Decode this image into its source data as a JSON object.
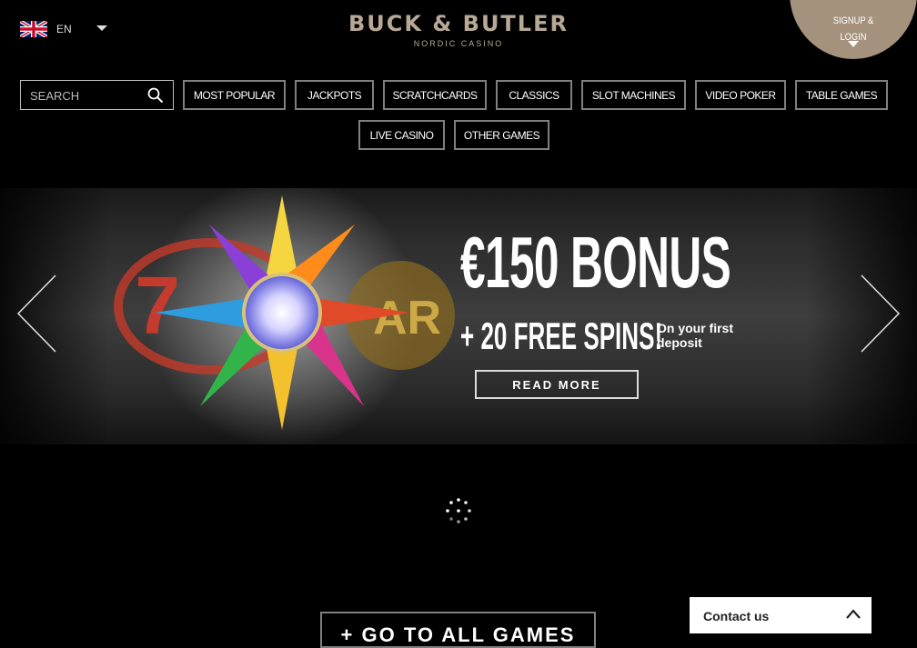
{
  "header": {
    "language": {
      "code": "EN",
      "flag_icon": "uk-flag-icon"
    },
    "brand": {
      "name": "BUCK & BUTLER",
      "subtitle": "NORDIC CASINO",
      "color": "#b7a995"
    },
    "signup": {
      "label_line1": "SIGNUP &",
      "label_line2": "LOGIN",
      "bg_color": "#a5927c"
    }
  },
  "search": {
    "placeholder": "SEARCH",
    "value": ""
  },
  "categories": [
    "MOST POPULAR",
    "JACKPOTS",
    "SCRATCHCARDS",
    "CLASSICS",
    "SLOT MACHINES",
    "VIDEO POKER",
    "TABLE GAMES",
    "LIVE CASINO",
    "OTHER GAMES"
  ],
  "banner": {
    "title": "€150 BONUS",
    "spins": "+ 20 FREE SPINS!",
    "note": "On your first deposit",
    "read_more": "READ MORE"
  },
  "footer": {
    "all_games": "+ GO TO ALL GAMES",
    "contact": "Contact us"
  }
}
